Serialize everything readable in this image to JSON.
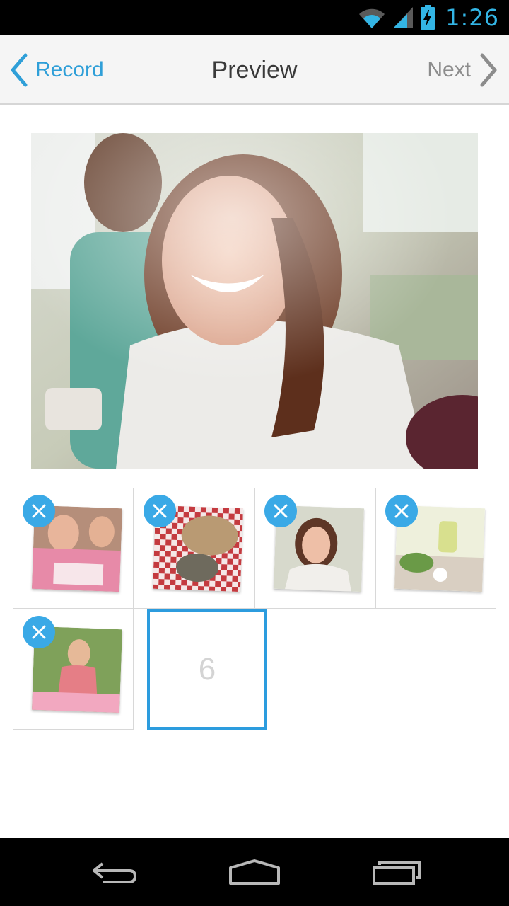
{
  "status_bar": {
    "time": "1:26",
    "icons": [
      "wifi-icon",
      "cell-signal-icon",
      "battery-charging-icon"
    ],
    "accent_color": "#33b5e5"
  },
  "action_bar": {
    "back_label": "Record",
    "title": "Preview",
    "next_label": "Next",
    "back_color": "#2f9fd8",
    "next_color": "#8c8c8c"
  },
  "preview": {
    "description_icon": "photo-preview"
  },
  "thumbnails": [
    {
      "name": "birthday-girls-photo",
      "remove_icon": "close-icon"
    },
    {
      "name": "picnic-basket-photo",
      "remove_icon": "close-icon"
    },
    {
      "name": "smiling-woman-photo",
      "remove_icon": "close-icon"
    },
    {
      "name": "flowers-bottle-photo",
      "remove_icon": "close-icon"
    },
    {
      "name": "birthday-cake-girl-photo",
      "remove_icon": "close-icon"
    }
  ],
  "empty_slot": {
    "number": "6",
    "accent_color": "#2c9cde"
  },
  "nav_bar": {
    "icons": [
      "back-nav-icon",
      "home-nav-icon",
      "recents-nav-icon"
    ]
  }
}
